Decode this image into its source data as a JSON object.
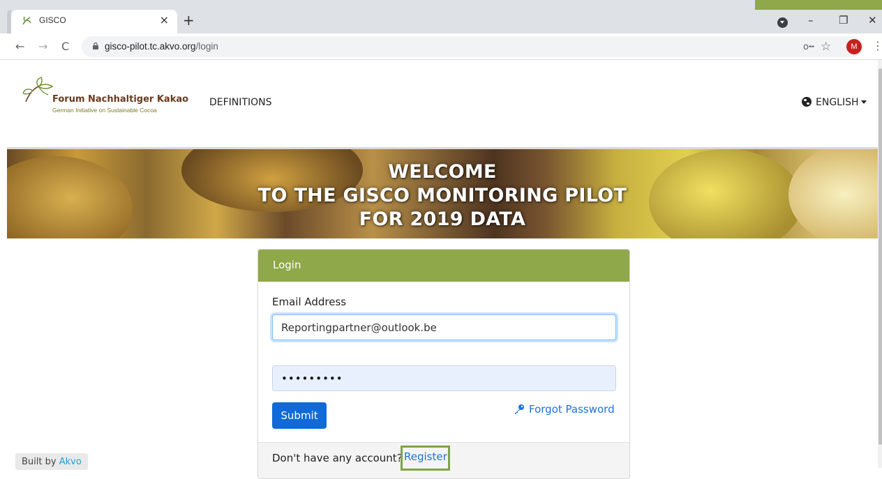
{
  "browser": {
    "tab_title": "GISCO",
    "tab_close": "×",
    "new_tab": "+",
    "url_host": "gisco-pilot.tc.akvo.org",
    "url_path": "/login",
    "avatar_initial": "M",
    "window_controls": {
      "minimize": "–",
      "restore": "❐",
      "close": "✕"
    },
    "nav": {
      "back": "←",
      "forward": "→",
      "reload": "C"
    },
    "icons": [
      "lock-icon",
      "key-icon",
      "star-icon",
      "kebab-menu-icon"
    ]
  },
  "header": {
    "logo_title": "Forum Nachhaltiger Kakao",
    "logo_subtitle": "German Initiative on Sustainable Cocoa",
    "nav_definitions": "DEFINITIONS",
    "language": "ENGLISH"
  },
  "hero": {
    "line1": "WELCOME",
    "line2": "TO THE GISCO MONITORING PILOT",
    "line3": "FOR 2019 DATA"
  },
  "login": {
    "title": "Login",
    "email_label": "Email Address",
    "email_value": "Reportingpartner@outlook.be",
    "password_value": "•••••••••",
    "submit_label": "Submit",
    "forgot_label": "Forgot Password",
    "no_account_text": "Don't have any account?",
    "register_label": "Register"
  },
  "footer": {
    "built_by": "Built by",
    "akvo": "Akvo"
  },
  "colors": {
    "brand_green": "#8fa84a",
    "primary_blue": "#0f6ad8",
    "link_blue": "#1a73d9",
    "logo_brown": "#6b3a1d"
  }
}
